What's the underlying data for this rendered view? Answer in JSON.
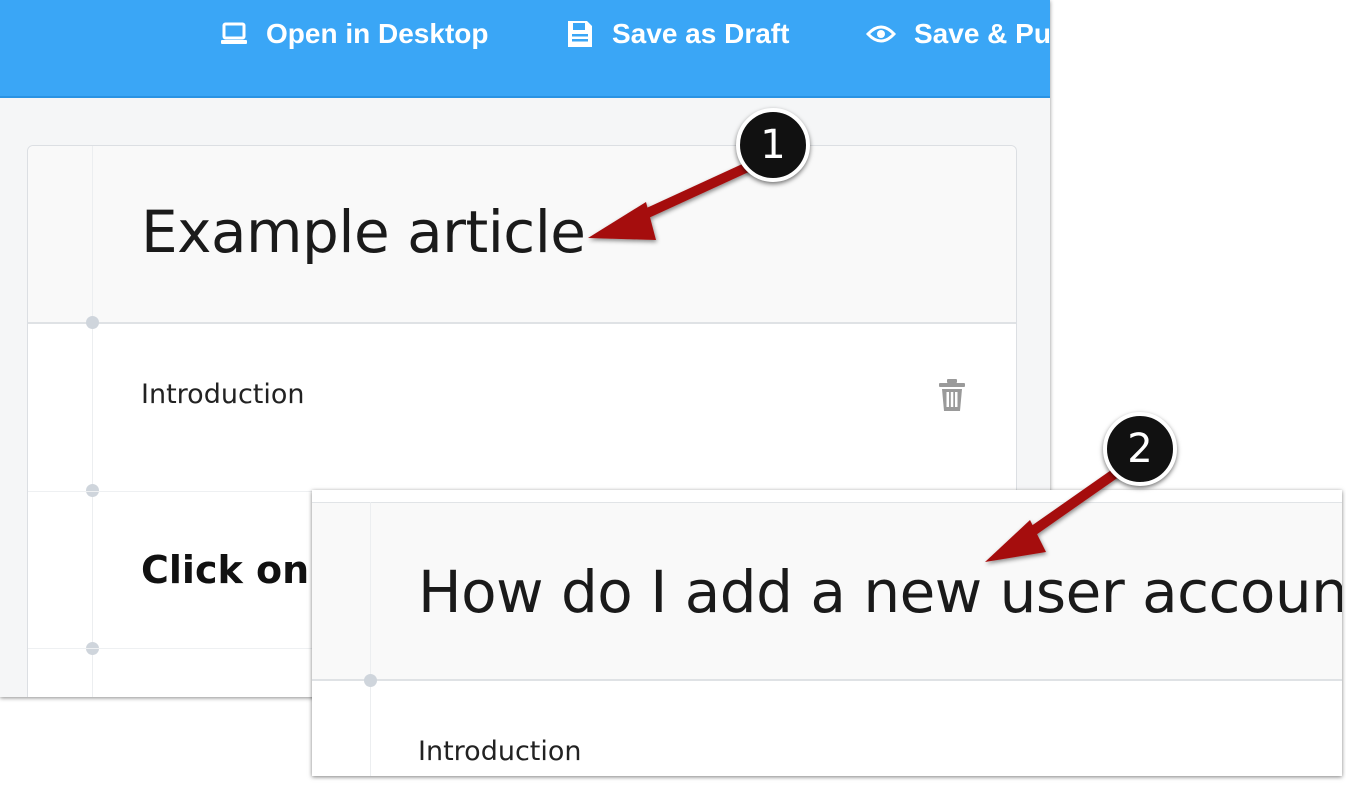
{
  "toolbar": {
    "open_desktop_label": "Open in Desktop",
    "save_draft_label": "Save as Draft",
    "save_publish_label": "Save & Pu"
  },
  "article": {
    "title": "Example article",
    "section_label": "Introduction",
    "step_text": "Click on"
  },
  "front_article": {
    "title": "How do I add a new user account?",
    "section_label": "Introduction"
  },
  "annotations": {
    "badge_1": "1",
    "badge_2": "2"
  },
  "icons": {
    "open_desktop": "laptop-icon",
    "save_draft": "floppy-disk-icon",
    "save_publish": "eye-icon",
    "delete": "trash-icon"
  },
  "colors": {
    "toolbar_bg": "#3aa6f6",
    "arrow": "#a50f0f",
    "badge_bg": "#111111"
  }
}
